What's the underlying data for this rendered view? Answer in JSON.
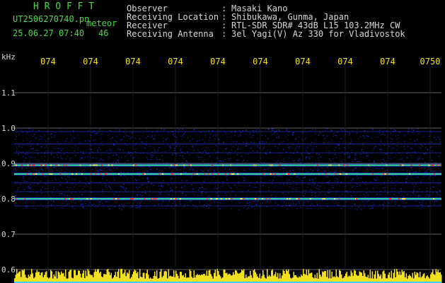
{
  "header": {
    "brand": "H R O F F T",
    "filename": "UT2506270740.pn",
    "meteor_label": "meteor",
    "date_time": "25.06.27 07:40",
    "meteor_count": "46",
    "fields": [
      {
        "label": "Observer",
        "value": "Masaki Kano"
      },
      {
        "label": "Receiving Location",
        "value": "Shibukawa, Gunma, Japan"
      },
      {
        "label": "Receiver",
        "value": "RTL-SDR SDR# 43dB L15 103.2MHz CW"
      },
      {
        "label": "Receiving Antenna",
        "value": "3el Yagi(V) Az 330 for Vladivostok"
      }
    ]
  },
  "chart_data": {
    "type": "heatmap",
    "ylabel": "kHz",
    "y_ticks": [
      "1.1",
      "1.0",
      "0.9",
      "0.8",
      "0.7",
      "0.6"
    ],
    "x_ticks": [
      "074",
      "074",
      "074",
      "074",
      "074",
      "074",
      "074",
      "074",
      "074",
      "0750"
    ],
    "ylim": [
      0.6,
      1.15
    ],
    "strong_lines_khz": [
      0.895,
      0.87,
      0.8
    ],
    "band_khz": [
      0.77,
      1.0
    ],
    "colors": {
      "bg": "#000000",
      "grid": "#606060",
      "axis_text": "#d8d8d8",
      "time_text": "#f0e020",
      "noise": "#1e32ff",
      "line": "#40ff80",
      "bar": "#f0e020"
    }
  }
}
